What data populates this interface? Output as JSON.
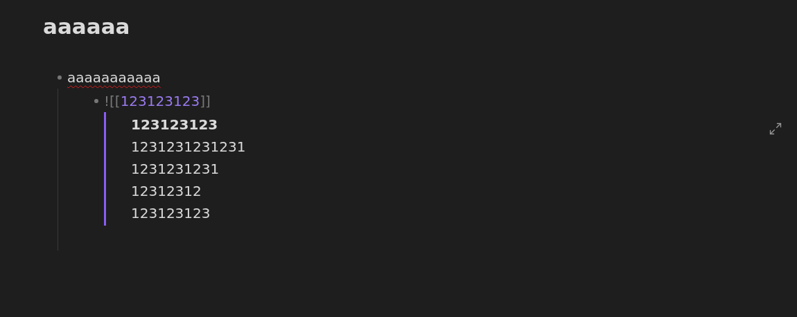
{
  "title": "aaaaaa",
  "items": [
    {
      "text": "aaaaaaaaaaa",
      "misspelled": true,
      "children": [
        {
          "kind": "embed",
          "prefix": "![[",
          "link": "123123123",
          "suffix": "]]",
          "embed": {
            "title": "123123123",
            "lines": [
              "1231231231231",
              "1231231231",
              "12312312",
              "123123123"
            ]
          }
        }
      ]
    }
  ]
}
